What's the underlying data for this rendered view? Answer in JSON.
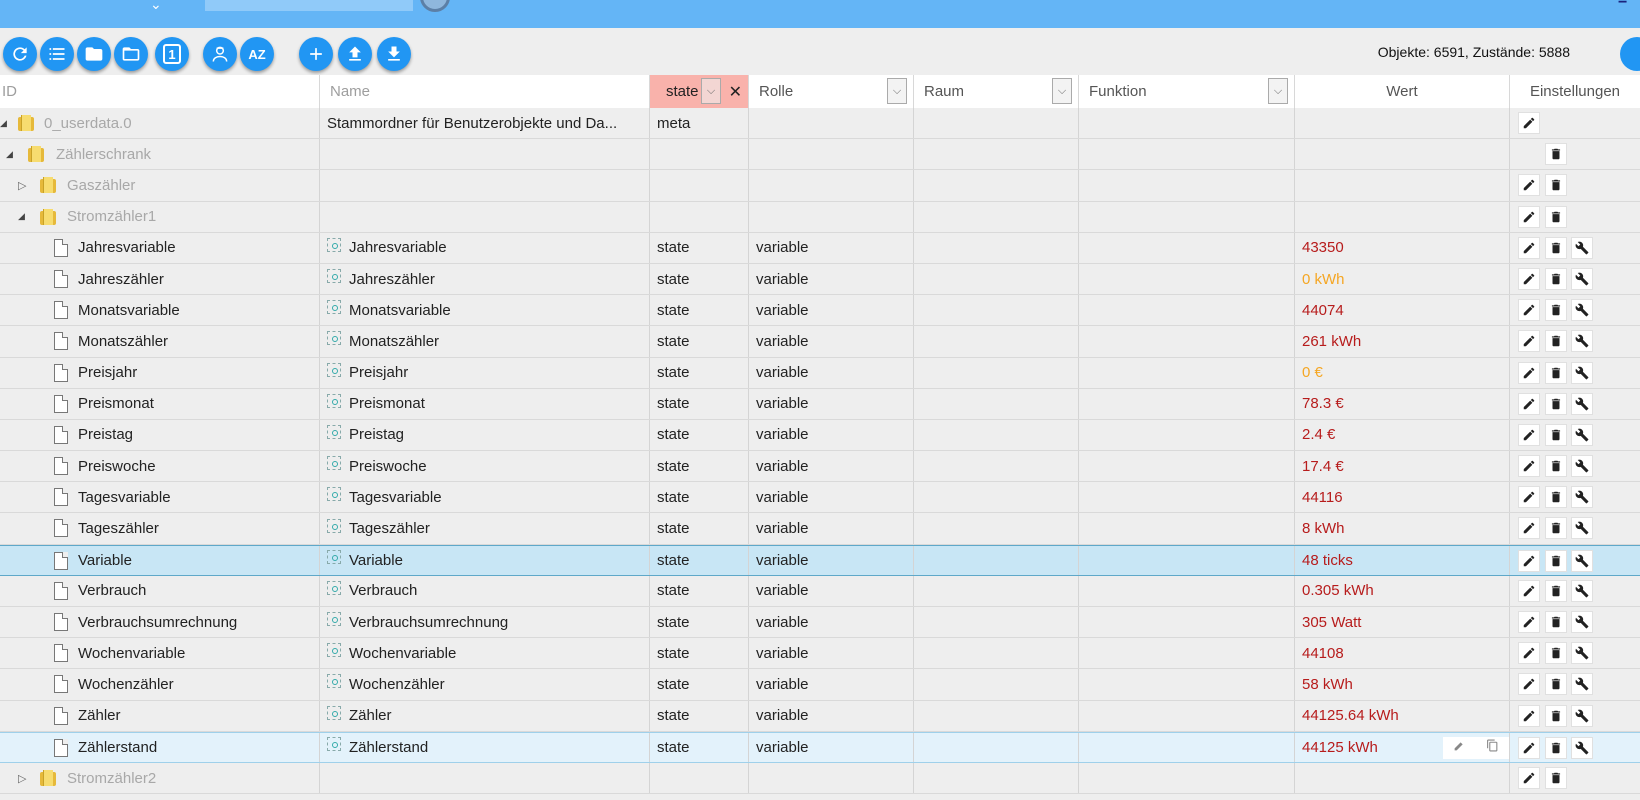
{
  "toolbar": {
    "buttons": [
      {
        "name": "refresh-button",
        "icon": "refresh-icon"
      },
      {
        "name": "list-view-button",
        "icon": "list-icon"
      },
      {
        "name": "folder-button",
        "icon": "folder-filled-icon"
      },
      {
        "name": "folder-open-button",
        "icon": "folder-outline-icon"
      },
      {
        "name": "one-button",
        "icon": "number-one-icon"
      },
      {
        "name": "expert-mode-button",
        "icon": "user-expert-icon"
      },
      {
        "name": "sort-button",
        "icon": "sort-az-icon"
      },
      {
        "name": "add-button",
        "icon": "plus-icon"
      },
      {
        "name": "upload-button",
        "icon": "upload-icon"
      },
      {
        "name": "download-button",
        "icon": "download-icon"
      }
    ],
    "sort_label": "AZ",
    "count_label": "1",
    "counts": "Objekte: 6591, Zustände: 5888"
  },
  "header": {
    "id": "ID",
    "name": "Name",
    "type_filter": "state",
    "role": "Rolle",
    "room": "Raum",
    "function": "Funktion",
    "value": "Wert",
    "settings": "Einstellungen"
  },
  "colors": {
    "topbar": "#64b5f6",
    "accent": "#2196f3",
    "value_red": "#b71c1c",
    "value_orange": "#f5a623",
    "filter_bg": "#f9b2ab",
    "selected_row": "#c8e6f5"
  },
  "rows": [
    {
      "level": 0,
      "kind": "folder",
      "expanded": true,
      "id": "0_userdata.0",
      "name": "Stammordner für Benutzerobjekte und Da...",
      "type": "meta",
      "role": "",
      "value": "",
      "actions": [
        "edit"
      ]
    },
    {
      "level": 1,
      "kind": "folder",
      "expanded": true,
      "id": "Zählerschrank",
      "name": "",
      "type": "",
      "role": "",
      "value": "",
      "actions": [
        "delete"
      ]
    },
    {
      "level": 2,
      "kind": "folder",
      "expanded": false,
      "id": "Gaszähler",
      "name": "",
      "type": "",
      "role": "",
      "value": "",
      "actions": [
        "edit",
        "delete"
      ]
    },
    {
      "level": 2,
      "kind": "folder",
      "expanded": true,
      "id": "Stromzähler1",
      "name": "",
      "type": "",
      "role": "",
      "value": "",
      "actions": [
        "edit",
        "delete"
      ]
    },
    {
      "level": 3,
      "kind": "state",
      "id": "Jahresvariable",
      "name": "Jahresvariable",
      "type": "state",
      "role": "variable",
      "value": "43350",
      "value_color": "red",
      "actions": [
        "edit",
        "delete",
        "config"
      ]
    },
    {
      "level": 3,
      "kind": "state",
      "id": "Jahreszähler",
      "name": "Jahreszähler",
      "type": "state",
      "role": "variable",
      "value": "0 kWh",
      "value_color": "orange",
      "actions": [
        "edit",
        "delete",
        "config"
      ]
    },
    {
      "level": 3,
      "kind": "state",
      "id": "Monatsvariable",
      "name": "Monatsvariable",
      "type": "state",
      "role": "variable",
      "value": "44074",
      "value_color": "red",
      "actions": [
        "edit",
        "delete",
        "config"
      ]
    },
    {
      "level": 3,
      "kind": "state",
      "id": "Monatszähler",
      "name": "Monatszähler",
      "type": "state",
      "role": "variable",
      "value": "261 kWh",
      "value_color": "red",
      "actions": [
        "edit",
        "delete",
        "config"
      ]
    },
    {
      "level": 3,
      "kind": "state",
      "id": "Preisjahr",
      "name": "Preisjahr",
      "type": "state",
      "role": "variable",
      "value": "0 €",
      "value_color": "orange",
      "actions": [
        "edit",
        "delete",
        "config"
      ]
    },
    {
      "level": 3,
      "kind": "state",
      "id": "Preismonat",
      "name": "Preismonat",
      "type": "state",
      "role": "variable",
      "value": "78.3 €",
      "value_color": "red",
      "actions": [
        "edit",
        "delete",
        "config"
      ]
    },
    {
      "level": 3,
      "kind": "state",
      "id": "Preistag",
      "name": "Preistag",
      "type": "state",
      "role": "variable",
      "value": "2.4 €",
      "value_color": "red",
      "actions": [
        "edit",
        "delete",
        "config"
      ]
    },
    {
      "level": 3,
      "kind": "state",
      "id": "Preiswoche",
      "name": "Preiswoche",
      "type": "state",
      "role": "variable",
      "value": "17.4 €",
      "value_color": "red",
      "actions": [
        "edit",
        "delete",
        "config"
      ]
    },
    {
      "level": 3,
      "kind": "state",
      "id": "Tagesvariable",
      "name": "Tagesvariable",
      "type": "state",
      "role": "variable",
      "value": "44116",
      "value_color": "red",
      "actions": [
        "edit",
        "delete",
        "config"
      ]
    },
    {
      "level": 3,
      "kind": "state",
      "id": "Tageszähler",
      "name": "Tageszähler",
      "type": "state",
      "role": "variable",
      "value": "8 kWh",
      "value_color": "red",
      "actions": [
        "edit",
        "delete",
        "config"
      ]
    },
    {
      "level": 3,
      "kind": "state",
      "id": "Variable",
      "name": "Variable",
      "type": "state",
      "role": "variable",
      "value": "48 ticks",
      "value_color": "red",
      "selected": true,
      "actions": [
        "edit",
        "delete",
        "config"
      ]
    },
    {
      "level": 3,
      "kind": "state",
      "id": "Verbrauch",
      "name": "Verbrauch",
      "type": "state",
      "role": "variable",
      "value": "0.305 kWh",
      "value_color": "red",
      "actions": [
        "edit",
        "delete",
        "config"
      ]
    },
    {
      "level": 3,
      "kind": "state",
      "id": "Verbrauchsumrechnung",
      "name": "Verbrauchsumrechnung",
      "type": "state",
      "role": "variable",
      "value": "305 Watt",
      "value_color": "red",
      "actions": [
        "edit",
        "delete",
        "config"
      ]
    },
    {
      "level": 3,
      "kind": "state",
      "id": "Wochenvariable",
      "name": "Wochenvariable",
      "type": "state",
      "role": "variable",
      "value": "44108",
      "value_color": "red",
      "actions": [
        "edit",
        "delete",
        "config"
      ]
    },
    {
      "level": 3,
      "kind": "state",
      "id": "Wochenzähler",
      "name": "Wochenzähler",
      "type": "state",
      "role": "variable",
      "value": "58 kWh",
      "value_color": "red",
      "actions": [
        "edit",
        "delete",
        "config"
      ]
    },
    {
      "level": 3,
      "kind": "state",
      "id": "Zähler",
      "name": "Zähler",
      "type": "state",
      "role": "variable",
      "value": "44125.64 kWh",
      "value_color": "red",
      "actions": [
        "edit",
        "delete",
        "config"
      ]
    },
    {
      "level": 3,
      "kind": "state",
      "id": "Zählerstand",
      "name": "Zählerstand",
      "type": "state",
      "role": "variable",
      "value": "44125 kWh",
      "value_color": "red",
      "hover": true,
      "actions": [
        "edit",
        "delete",
        "config"
      ]
    },
    {
      "level": 2,
      "kind": "folder",
      "expanded": false,
      "id": "Stromzähler2",
      "name": "",
      "type": "",
      "role": "",
      "value": "",
      "actions": [
        "edit",
        "delete"
      ]
    }
  ]
}
